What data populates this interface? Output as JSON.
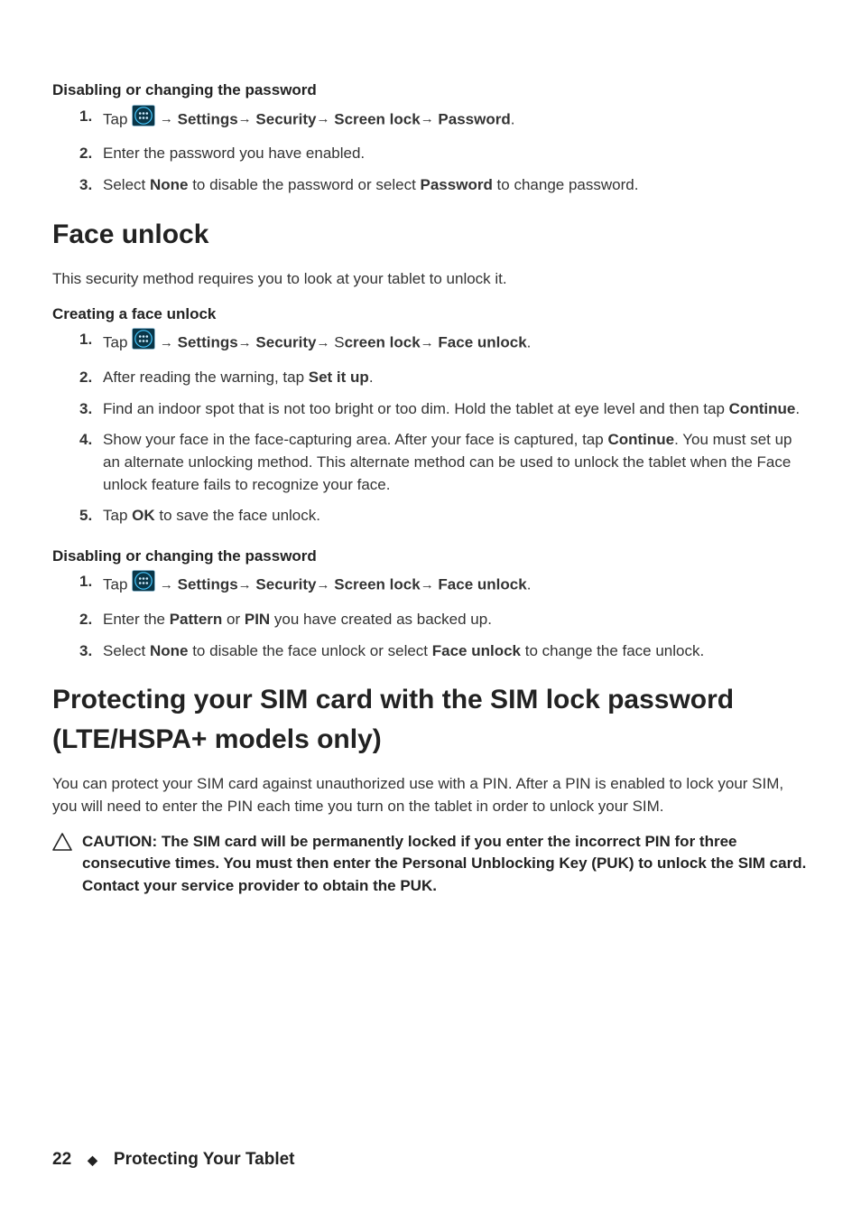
{
  "section_disable_pw": {
    "heading": "Disabling or changing the password",
    "steps": [
      {
        "num": "1.",
        "parts": [
          "Tap ",
          {
            "icon": "apps"
          },
          " → ",
          {
            "b": "Settings"
          },
          "→ ",
          {
            "b": "Security"
          },
          "→ ",
          {
            "b": "Screen lock"
          },
          "→ ",
          {
            "b": "Password"
          },
          "."
        ]
      },
      {
        "num": "2.",
        "parts": [
          "Enter the password you have enabled."
        ]
      },
      {
        "num": "3.",
        "parts": [
          "Select ",
          {
            "b": "None"
          },
          " to disable the password or select ",
          {
            "b": "Password"
          },
          " to change password."
        ]
      }
    ]
  },
  "face_unlock": {
    "heading": "Face unlock",
    "intro": "This security method requires you to look at your tablet to unlock it.",
    "creating": {
      "heading": "Creating a face unlock",
      "steps": [
        {
          "num": "1.",
          "parts": [
            "Tap ",
            {
              "icon": "apps"
            },
            " → ",
            {
              "b": "Settings"
            },
            "→ ",
            {
              "b": "Security"
            },
            "→ S",
            {
              "b": "creen lock"
            },
            "→ ",
            {
              "b": "Face unlock"
            },
            "."
          ]
        },
        {
          "num": "2.",
          "parts": [
            "After reading the warning, tap ",
            {
              "b": "Set it up"
            },
            "."
          ]
        },
        {
          "num": "3.",
          "parts": [
            "Find an indoor spot that is not too bright or too dim. Hold the tablet at eye level and then tap ",
            {
              "b": "Continue"
            },
            "."
          ]
        },
        {
          "num": "4.",
          "parts": [
            "Show your face in the face-capturing area. After your face is captured, tap ",
            {
              "b": "Continue"
            },
            ". You must set up an alternate unlocking method. This alternate method can be used to unlock the tablet when the Face unlock feature fails to recognize your face."
          ]
        },
        {
          "num": "5.",
          "parts": [
            "Tap ",
            {
              "b": "OK"
            },
            " to save the face unlock."
          ]
        }
      ]
    },
    "disabling": {
      "heading": "Disabling or changing the password",
      "steps": [
        {
          "num": "1.",
          "parts": [
            "Tap ",
            {
              "icon": "apps"
            },
            " → ",
            {
              "b": "Settings"
            },
            "→ ",
            {
              "b": "Security"
            },
            "→ ",
            {
              "b": "Screen lock"
            },
            "→ ",
            {
              "b": "Face unlock"
            },
            "."
          ]
        },
        {
          "num": "2.",
          "parts": [
            "Enter the ",
            {
              "b": "Pattern"
            },
            " or ",
            {
              "b": "PIN"
            },
            " you have created as backed up."
          ]
        },
        {
          "num": "3.",
          "parts": [
            "Select ",
            {
              "b": "None"
            },
            " to disable the face unlock or select ",
            {
              "b": "Face unlock"
            },
            " to change the face unlock."
          ]
        }
      ]
    }
  },
  "sim_lock": {
    "heading": "Protecting your SIM card with the SIM lock password (LTE/HSPA+ models only)",
    "intro": "You can protect your SIM card against unauthorized use with a PIN. After a PIN is enabled to lock your SIM, you will need to enter the PIN each time you turn on the tablet in order to unlock your SIM.",
    "caution": "CAUTION: The SIM card will be permanently locked if you enter the incorrect PIN for three  consecutive times. You must then enter the Personal Unblocking Key (PUK) to unlock the SIM card. Contact your service provider to obtain the PUK."
  },
  "footer": {
    "page_number": "22",
    "section_title": "Protecting Your Tablet"
  }
}
